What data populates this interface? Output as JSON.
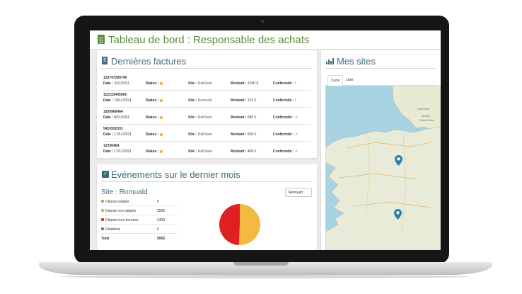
{
  "page": {
    "title": "Tableau de bord : Responsable des achats"
  },
  "invoices": {
    "title": "Dernières factures",
    "labels": {
      "date": "Date :",
      "status": "Status :",
      "site": "Site :",
      "amount": "Montant :",
      "compliance": "Conformité :"
    },
    "rows": [
      {
        "id": "125747290746",
        "date": "3/11/2021",
        "site": "RatDown",
        "amount": "1200 €",
        "compliant": false
      },
      {
        "id": "112233445566",
        "date": "10/11/2021",
        "site": "Romuald",
        "amount": "133 €",
        "compliant": false
      },
      {
        "id": "1559966464",
        "date": "8/11/2021",
        "site": "RatDown",
        "amount": "685 €",
        "compliant": true
      },
      {
        "id": "5415552331",
        "date": "17/11/2021",
        "site": "RatDown",
        "amount": "600 €",
        "compliant": true
      },
      {
        "id": "12256464",
        "date": "17/11/2021",
        "site": "RatDown",
        "amount": "400 €",
        "compliant": true
      }
    ]
  },
  "events": {
    "title": "Evénements sur le dernier mois",
    "site_title": "Site : Romuald",
    "select_value": "Romuald",
    "rows": [
      {
        "label": "Dépots badgés",
        "value": "0",
        "color": "#8cc152"
      },
      {
        "label": "Dépots non badgés",
        "value": "2566",
        "color": "#f0ad2e"
      },
      {
        "label": "Dépots hors-horaires",
        "value": "2499",
        "color": "#d9343a"
      },
      {
        "label": "Rotations",
        "value": "0",
        "color": "#3c8dbc"
      }
    ],
    "total_label": "Total",
    "total_value": "5065",
    "pie_colors": {
      "non_badges": "#f4b940",
      "hors_horaires": "#e02020"
    }
  },
  "sites": {
    "title": "Mes sites",
    "tabs": [
      "Carte",
      "Liste"
    ],
    "map_labels": [
      "Guernsey",
      "Jersey",
      "Saint-Helier"
    ]
  }
}
